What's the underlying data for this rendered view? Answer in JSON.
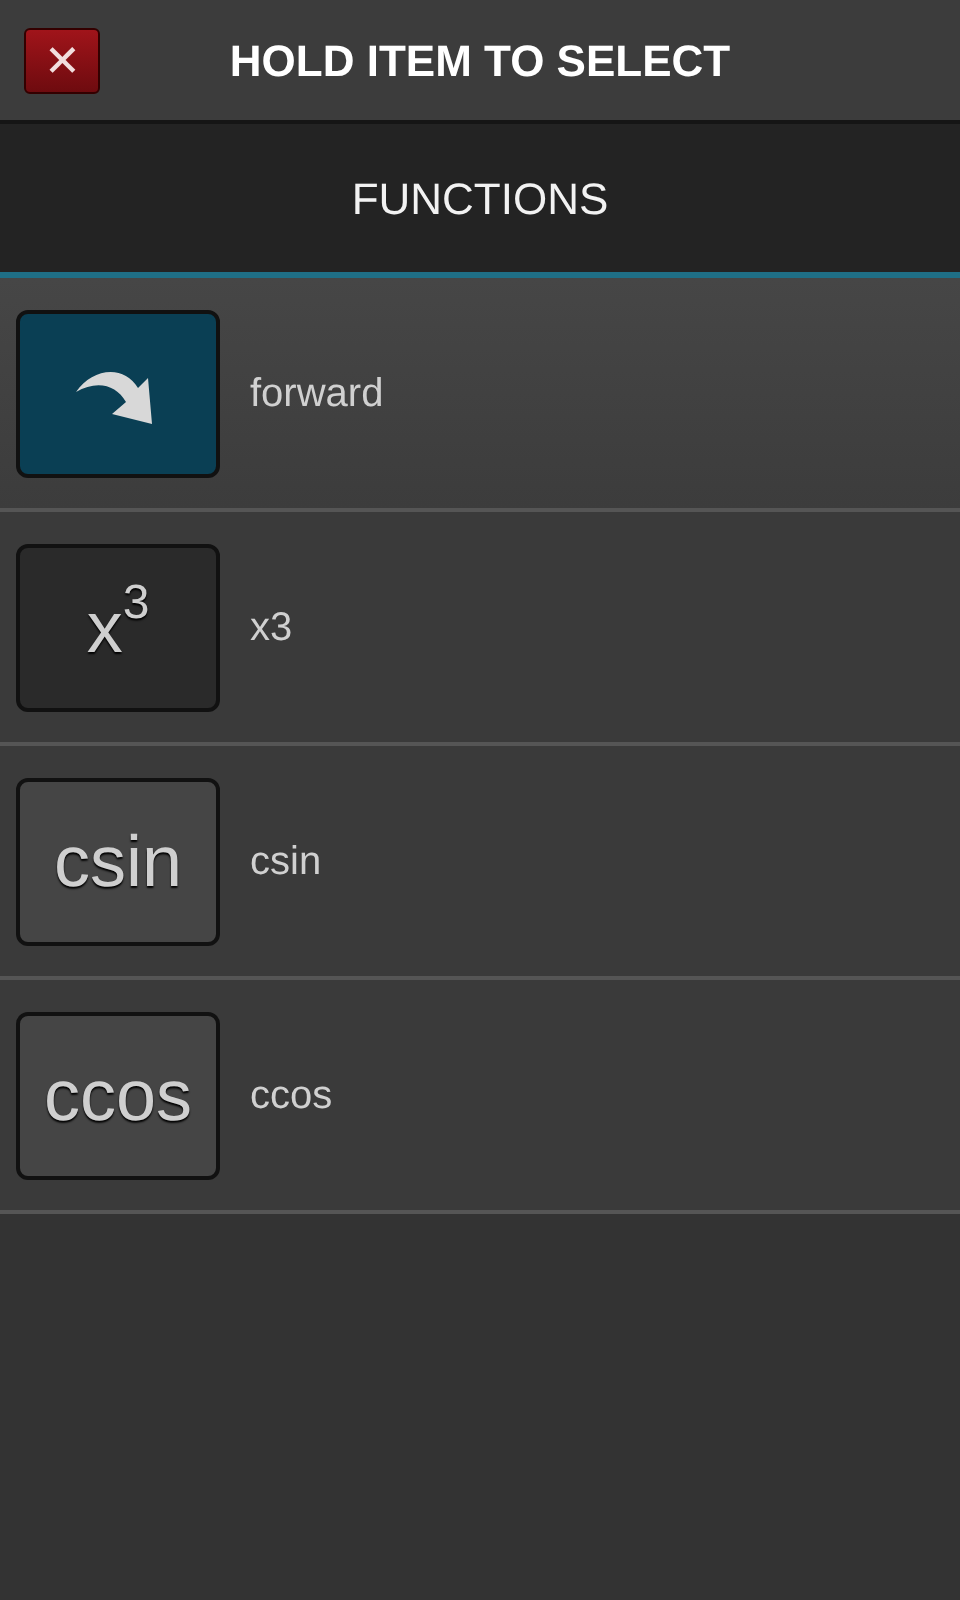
{
  "top_bar": {
    "close_icon": "✕",
    "title": "HOLD ITEM TO SELECT"
  },
  "header": {
    "title": "FUNCTIONS"
  },
  "items": [
    {
      "kind": "arrow",
      "color": "#0a3f54",
      "label": "forward",
      "selected": true
    },
    {
      "kind": "text",
      "color": "#2a2a2a",
      "key": "x$^{3}$",
      "label": "x3",
      "selected": false
    },
    {
      "kind": "text",
      "color": "#454545",
      "key": "csin",
      "label": "csin",
      "selected": false
    },
    {
      "kind": "text",
      "color": "#454545",
      "key": "ccos",
      "label": "ccos",
      "selected": false
    }
  ]
}
